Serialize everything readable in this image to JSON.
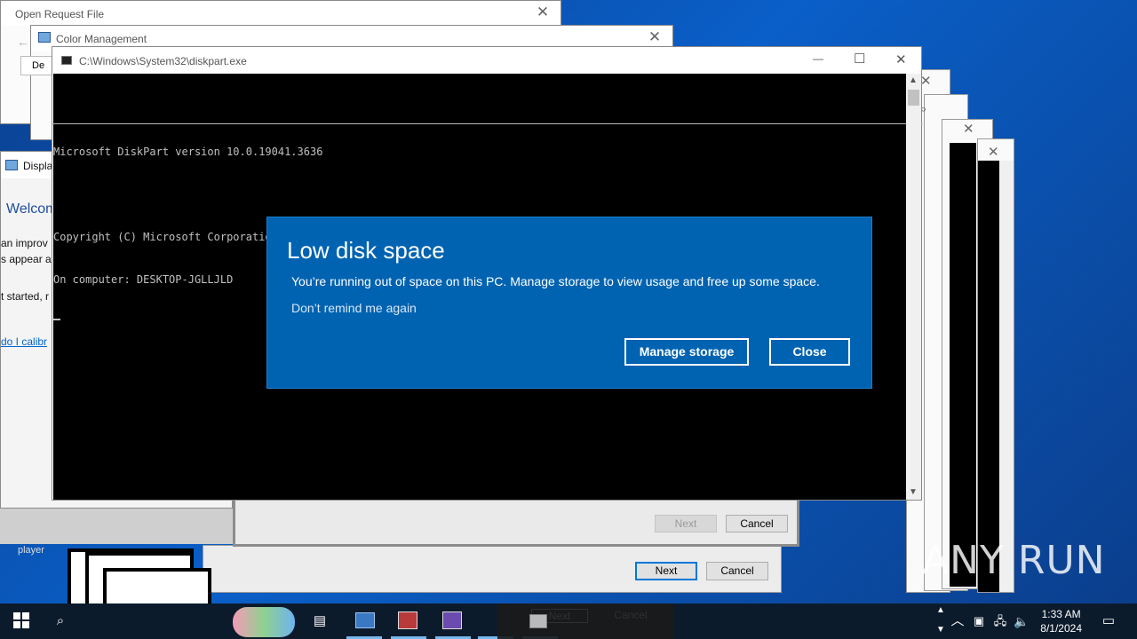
{
  "windows": {
    "open_request": {
      "title": "Open Request File",
      "close": "✕"
    },
    "color_mgmt": {
      "title": "Color Management",
      "close": "✕",
      "tab_partial": "De"
    },
    "display": {
      "title_partial": "Display",
      "welcome_partial": "Welcom",
      "line1_partial": "an improv",
      "line2_partial": "s appear a",
      "line3_partial": "t started, r",
      "link_partial": "do I calibr",
      "next_label": "Next",
      "cancel_label": "Cancel",
      "player_partial": "player"
    },
    "wizard": {
      "next_label": "Next",
      "cancel_label": "Cancel"
    },
    "diskpart": {
      "title": "C:\\Windows\\System32\\diskpart.exe",
      "lines": [
        "Microsoft DiskPart version 10.0.19041.3636",
        "",
        "Copyright (C) Microsoft Corporation.",
        "On computer: DESKTOP-JGLLJLD"
      ],
      "minimize": "—",
      "maximize": "☐",
      "close": "✕"
    }
  },
  "toast": {
    "title": "Low disk space",
    "message": "You’re running out of space on this PC. Manage storage to view usage and free up some space.",
    "dont_remind": "Don’t remind me again",
    "manage_label": "Manage storage",
    "close_label": "Close"
  },
  "taskbar": {
    "time": "1:33 AM",
    "date": "8/1/2024",
    "ghost_next": "Next",
    "ghost_cancel": "Cancel"
  },
  "watermark": "ANY RUN",
  "colors": {
    "toast_bg": "#0063b1",
    "taskbar_bg": "#0c1b2c",
    "desktop": "#0a5fc8"
  }
}
